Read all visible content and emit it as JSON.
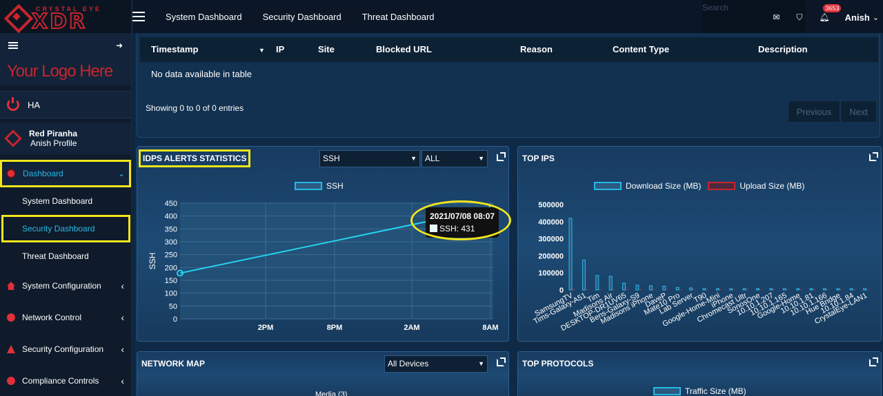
{
  "brand": {
    "small": "CRYSTAL EYE",
    "main": "XDR",
    "logo_text": "Your Logo Here"
  },
  "sidebar": {
    "ha_label": "HA",
    "profile_name": "Red Piranha",
    "profile_sub": "Anish Profile",
    "dashboard_label": "Dashboard",
    "sub_items": [
      "System Dashboard",
      "Security Dashboard",
      "Threat Dashboard"
    ],
    "items": [
      "System Configuration",
      "Network Control",
      "Security Configuration",
      "Compliance Controls"
    ]
  },
  "topbar": {
    "links": [
      "System Dashboard",
      "Security Dashboard",
      "Threat Dashboard"
    ],
    "search_placeholder": "Search",
    "notification_count": "3653",
    "user": "Anish"
  },
  "blocked_table": {
    "columns": [
      "Timestamp",
      "IP",
      "Site",
      "Blocked URL",
      "Reason",
      "Content Type",
      "Description"
    ],
    "empty_text": "No data available in table",
    "info": "Showing 0 to 0 of 0 entries",
    "prev": "Previous",
    "next": "Next"
  },
  "idps": {
    "title": "IDPS ALERTS STATISTICS",
    "select_proto": "SSH",
    "select_scope": "ALL",
    "legend": "SSH",
    "ylabel": "SSH",
    "tooltip_time": "2021/07/08 08:07",
    "tooltip_value": "SSH: 431"
  },
  "top_ips": {
    "title": "TOP IPS",
    "legend_download": "Download Size (MB)",
    "legend_upload": "Upload Size (MB)"
  },
  "network_map": {
    "title": "NETWORK MAP",
    "select": "All Devices",
    "partial_label": "Media (3)"
  },
  "top_protocols": {
    "title": "TOP PROTOCOLS",
    "legend": "Traffic Size (MB)"
  },
  "colors": {
    "accent": "#26b9e6",
    "highlight": "#f3e61a",
    "brand_red": "#c8252c",
    "upload": "#c8252c"
  },
  "chart_data": [
    {
      "type": "line",
      "title": "IDPS ALERTS STATISTICS",
      "ylabel": "SSH",
      "xticks": [
        "2PM",
        "8PM",
        "2AM",
        "8AM"
      ],
      "yticks": [
        0,
        50,
        100,
        150,
        200,
        250,
        300,
        350,
        400,
        450
      ],
      "ylim": [
        0,
        450
      ],
      "series": [
        {
          "name": "SSH",
          "points": [
            {
              "x": 0,
              "y": 178
            },
            {
              "x": 1,
              "y": 431
            }
          ]
        }
      ]
    },
    {
      "type": "bar",
      "title": "TOP IPS",
      "categories": [
        "SamsungTV",
        "Tims-Galaxy-A51",
        "Tim",
        "Madisons Air",
        "DESKTOP-DR1UV65",
        "Bens-Galaxy-S9",
        "Madisons iPhone",
        "DaveP",
        "Mate10 Pro",
        "Lab Server",
        "T90",
        "Google-Home-Mini",
        "iPhone",
        "Chromecast Ultr",
        "SonosOne",
        "10.10.1.207",
        "10.10.1.165",
        "Google-Home",
        "10.10.1.81",
        "10.10.1.166",
        "Hue Bridge",
        "10.10.1.84",
        "CrystalEye-LAN1"
      ],
      "yticks": [
        0,
        100000,
        200000,
        300000,
        400000,
        500000
      ],
      "ylim": [
        0,
        500000
      ],
      "series": [
        {
          "name": "Download Size (MB)",
          "values": [
            420000,
            175000,
            85000,
            80000,
            40000,
            28000,
            25000,
            22000,
            14000,
            12000,
            9000,
            8000,
            4000,
            3000,
            2500,
            1500,
            1000,
            500,
            500,
            500,
            300,
            300,
            200
          ]
        },
        {
          "name": "Upload Size (MB)",
          "values": [
            6000,
            3000,
            2000,
            2000,
            1500,
            1000,
            1000,
            1000,
            500,
            500,
            500,
            500,
            300,
            300,
            200,
            100,
            100,
            100,
            100,
            100,
            100,
            100,
            100
          ]
        }
      ]
    }
  ]
}
